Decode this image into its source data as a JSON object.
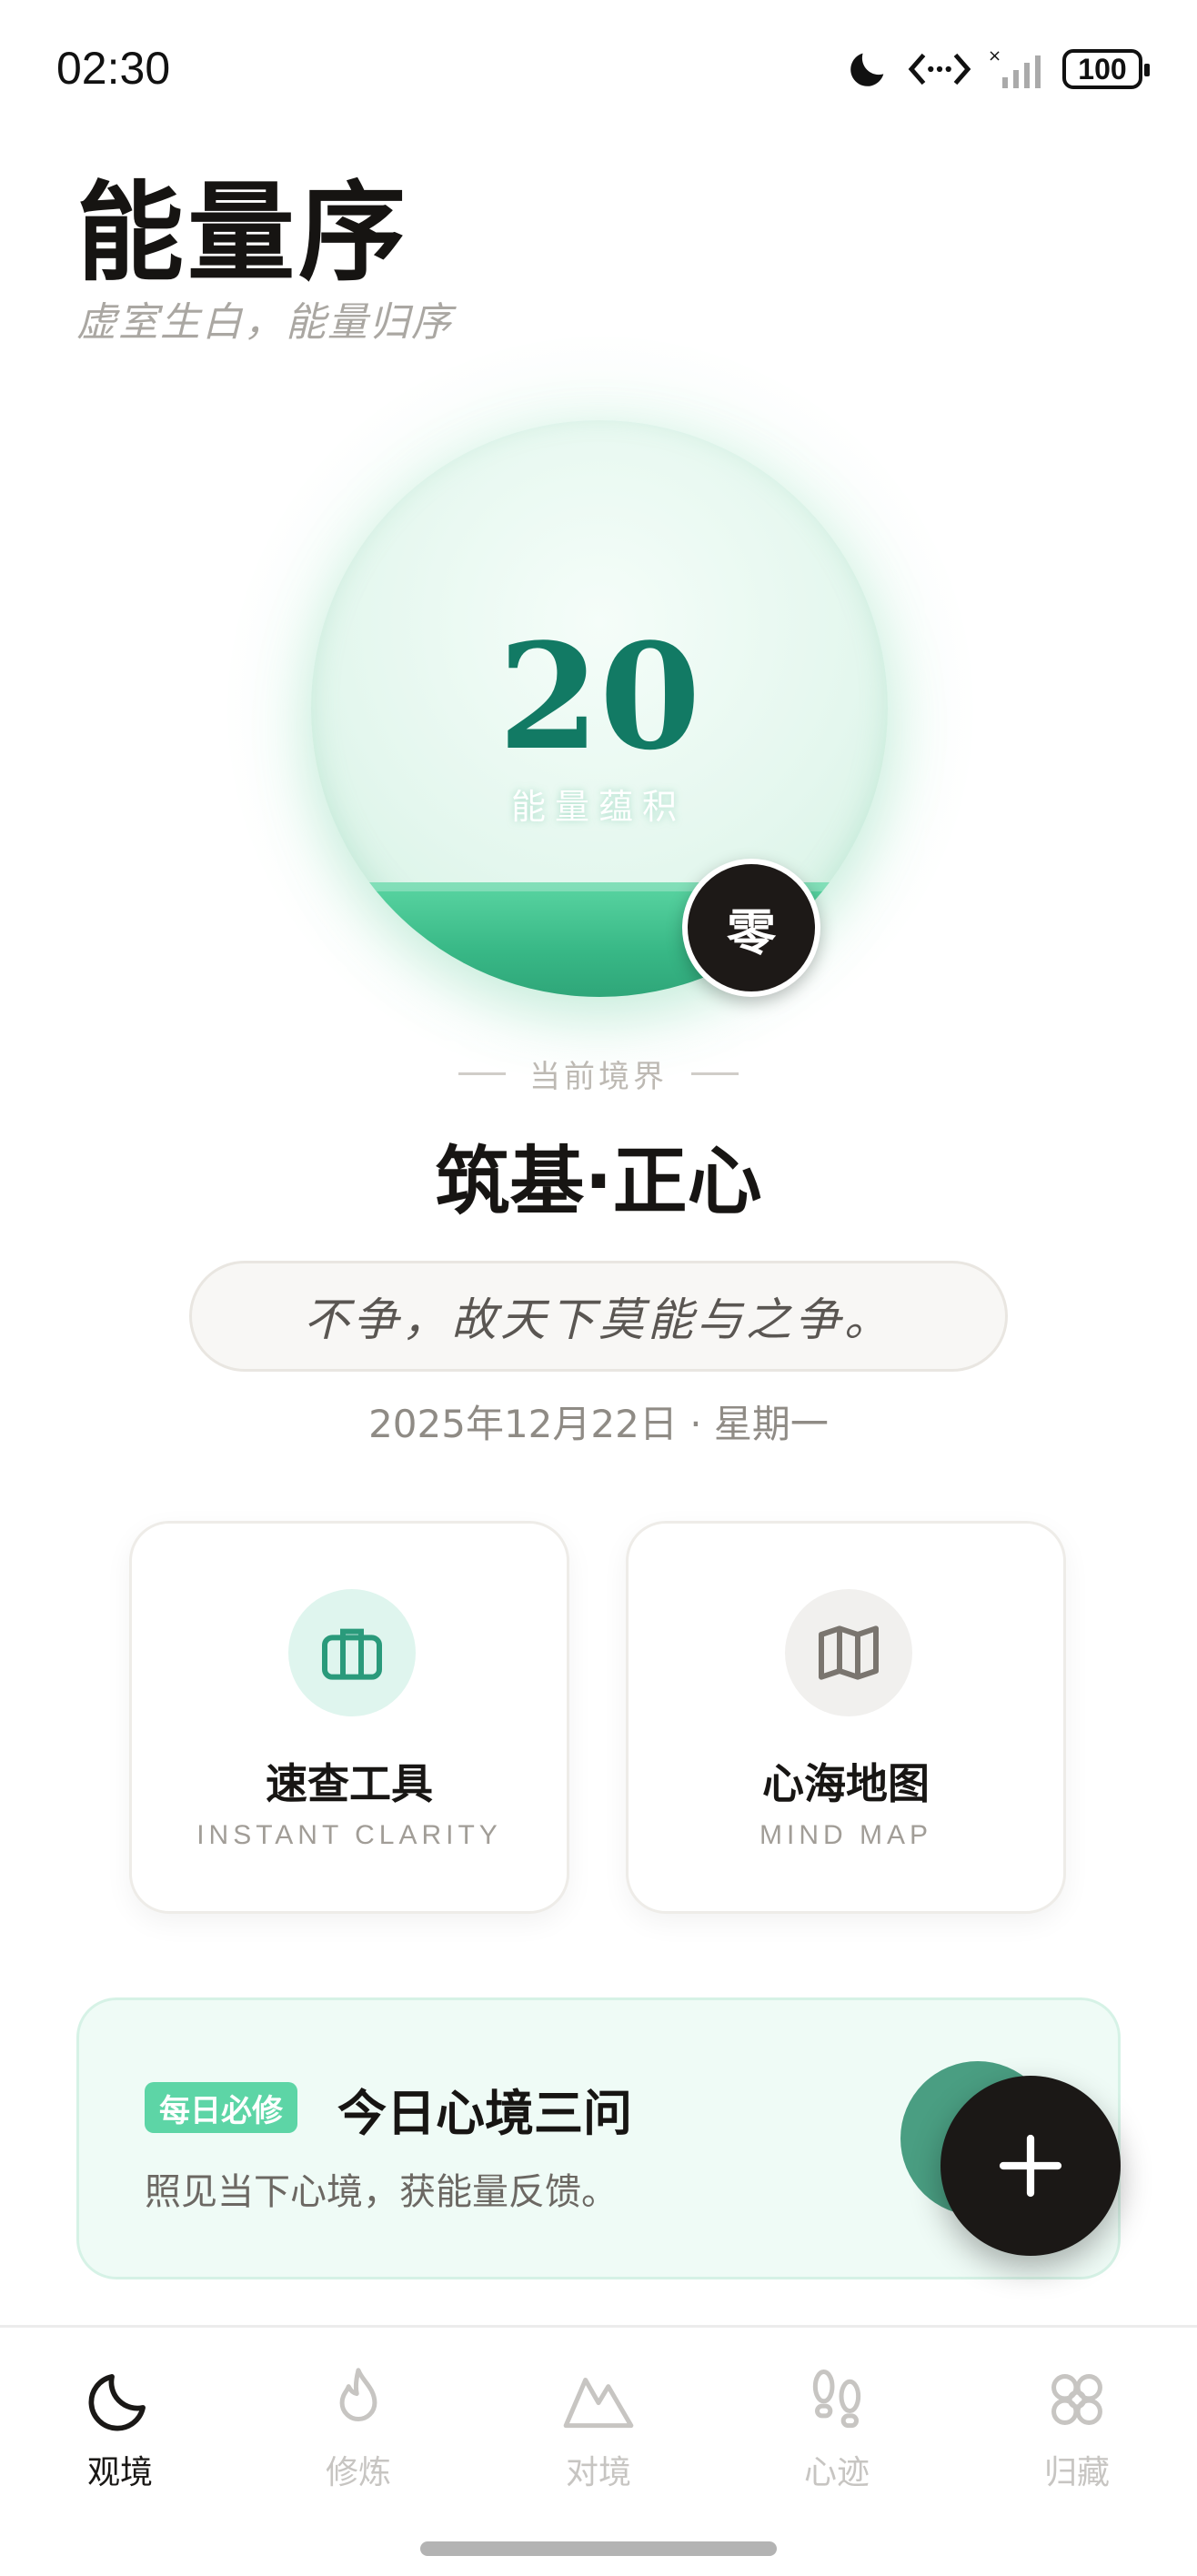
{
  "status_bar": {
    "time": "02:30",
    "icons": [
      "moon-icon",
      "data-transfer-icon",
      "signal-off-icon",
      "battery-icon"
    ],
    "battery": "100"
  },
  "header": {
    "title": "能量序",
    "subtitle": "虚室生白，能量归序"
  },
  "energy": {
    "value": "20",
    "label": "能量蕴积",
    "fill_fraction": 0.2,
    "level_badge": "零",
    "colors": {
      "liquid": "#3cc08e",
      "value": "#127a64",
      "badge": "#1d1917"
    }
  },
  "realm": {
    "caption": "当前境界",
    "name": "筑基·正心",
    "quote": "不争，故天下莫能与之争。",
    "date": "2025年12月22日 · 星期一"
  },
  "cards": [
    {
      "title": "速查工具",
      "subtitle": "INSTANT CLARITY",
      "icon": "briefcase-icon"
    },
    {
      "title": "心海地图",
      "subtitle": "MIND MAP",
      "icon": "map-icon"
    }
  ],
  "daily": {
    "tag": "每日必修",
    "title": "今日心境三问",
    "description": "照见当下心境，获能量反馈。",
    "fab_icon": "plus-icon"
  },
  "nav": {
    "items": [
      {
        "label": "观境",
        "icon": "moon-icon",
        "active": true
      },
      {
        "label": "修炼",
        "icon": "flame-icon",
        "active": false
      },
      {
        "label": "对境",
        "icon": "mountain-icon",
        "active": false
      },
      {
        "label": "心迹",
        "icon": "footprints-icon",
        "active": false
      },
      {
        "label": "归藏",
        "icon": "flower-icon",
        "active": false
      }
    ]
  },
  "colors": {
    "accent": "#5dd5a6",
    "dark": "#1b1816",
    "muted": "#a19d97"
  }
}
